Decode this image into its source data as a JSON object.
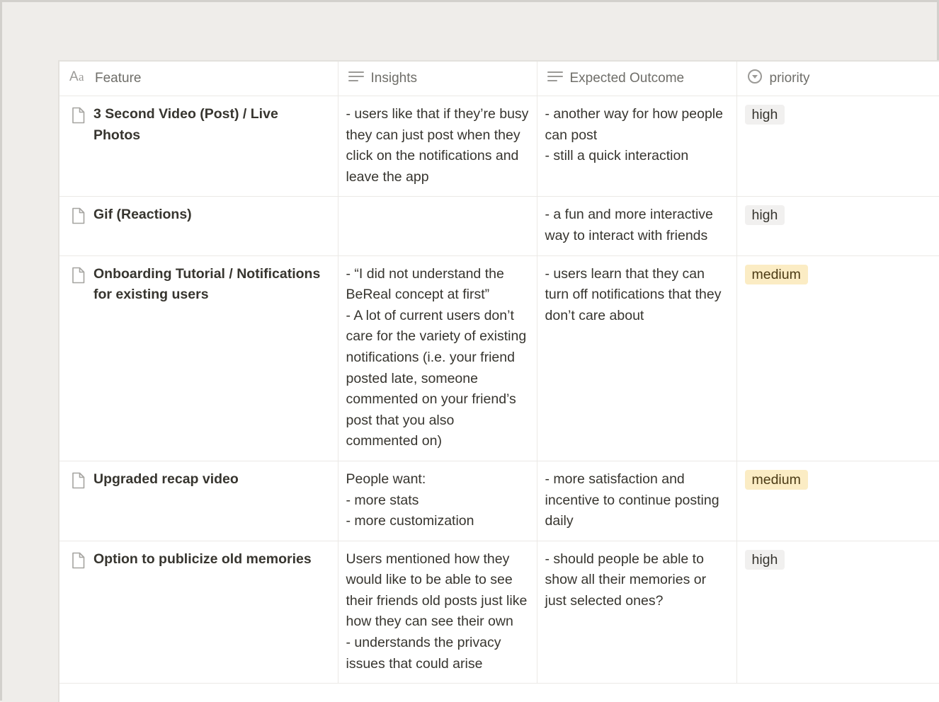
{
  "colors": {
    "tag_high_bg": "#f1f0ef",
    "tag_medium_bg": "#fbecc4"
  },
  "table": {
    "headers": {
      "feature": "Feature",
      "insights": "Insights",
      "outcome": "Expected Outcome",
      "priority": "priority"
    },
    "header_icons": {
      "feature": "title-aa-icon",
      "insights": "text-lines-icon",
      "outcome": "text-lines-icon",
      "priority": "select-circle-icon"
    },
    "rows": [
      {
        "feature": "3 Second Video (Post) / Live Photos",
        "insights": "- users like that if they’re busy they can just post when they click on the notifications and leave the app",
        "outcome": "- another way for how people can post\n- still a quick interaction",
        "priority": "high"
      },
      {
        "feature": "Gif (Reactions)",
        "insights": "",
        "outcome": "- a fun and more interactive way to interact with friends",
        "priority": "high"
      },
      {
        "feature": "Onboarding Tutorial / Notifications for existing users",
        "insights": "- “I did not understand the BeReal concept at first”\n- A lot of current users don’t care for the variety of existing notifications (i.e. your friend posted late, someone commented on your friend’s post that you also commented on)",
        "outcome": "- users learn that they can turn off notifications that they don’t care about",
        "priority": "medium"
      },
      {
        "feature": "Upgraded recap video",
        "insights": "People want:\n- more stats\n- more customization",
        "outcome": "- more satisfaction and incentive to continue posting daily",
        "priority": "medium"
      },
      {
        "feature": "Option to publicize old memories",
        "insights": "Users mentioned how they would like to be able to see their friends old posts just like how they can see their own\n- understands the privacy issues that could arise",
        "outcome": "- should people be able to show all their memories or just selected ones?",
        "priority": "high"
      }
    ]
  }
}
